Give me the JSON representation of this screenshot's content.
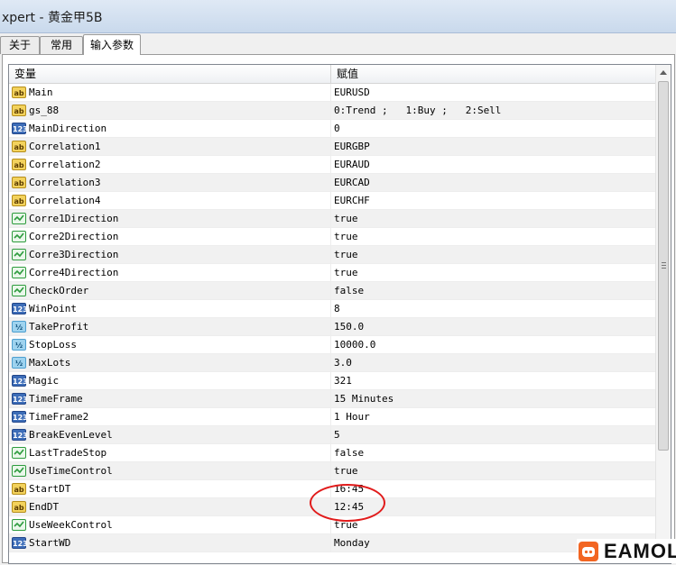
{
  "window": {
    "title": "xpert - 黄金甲5B"
  },
  "tabs": [
    {
      "label": "关于"
    },
    {
      "label": "常用"
    },
    {
      "label": "输入参数"
    }
  ],
  "table": {
    "headers": [
      "变量",
      "赋值"
    ],
    "rows": [
      {
        "type": "ab",
        "name": "Main",
        "value": "EURUSD"
      },
      {
        "type": "ab",
        "name": "gs_88",
        "value": "0:Trend ;   1:Buy ;   2:Sell"
      },
      {
        "type": "int",
        "name": "MainDirection",
        "value": "0"
      },
      {
        "type": "ab",
        "name": "Correlation1",
        "value": "EURGBP"
      },
      {
        "type": "ab",
        "name": "Correlation2",
        "value": "EURAUD"
      },
      {
        "type": "ab",
        "name": "Correlation3",
        "value": "EURCAD"
      },
      {
        "type": "ab",
        "name": "Correlation4",
        "value": "EURCHF"
      },
      {
        "type": "bool",
        "name": "Corre1Direction",
        "value": "true"
      },
      {
        "type": "bool",
        "name": "Corre2Direction",
        "value": "true"
      },
      {
        "type": "bool",
        "name": "Corre3Direction",
        "value": "true"
      },
      {
        "type": "bool",
        "name": "Corre4Direction",
        "value": "true"
      },
      {
        "type": "bool",
        "name": "CheckOrder",
        "value": "false"
      },
      {
        "type": "int",
        "name": "WinPoint",
        "value": "8"
      },
      {
        "type": "dbl",
        "name": "TakeProfit",
        "value": "150.0"
      },
      {
        "type": "dbl",
        "name": "StopLoss",
        "value": "10000.0"
      },
      {
        "type": "dbl",
        "name": "MaxLots",
        "value": "3.0"
      },
      {
        "type": "int",
        "name": "Magic",
        "value": "321"
      },
      {
        "type": "int",
        "name": "TimeFrame",
        "value": "15 Minutes"
      },
      {
        "type": "int",
        "name": "TimeFrame2",
        "value": "1 Hour"
      },
      {
        "type": "int",
        "name": "BreakEvenLevel",
        "value": "5"
      },
      {
        "type": "bool",
        "name": "LastTradeStop",
        "value": "false"
      },
      {
        "type": "bool",
        "name": "UseTimeControl",
        "value": "true"
      },
      {
        "type": "ab",
        "name": "StartDT",
        "value": "16:45"
      },
      {
        "type": "ab",
        "name": "EndDT",
        "value": "12:45"
      },
      {
        "type": "bool",
        "name": "UseWeekControl",
        "value": "true"
      },
      {
        "type": "int",
        "name": "StartWD",
        "value": "Monday"
      }
    ]
  },
  "icon_text": {
    "ab": "ab",
    "int": "123",
    "dbl": "½"
  },
  "colors": {
    "annotation": "#e11b1b",
    "logo_accent": "#f26522"
  },
  "watermark": {
    "text": "EAMOL"
  }
}
